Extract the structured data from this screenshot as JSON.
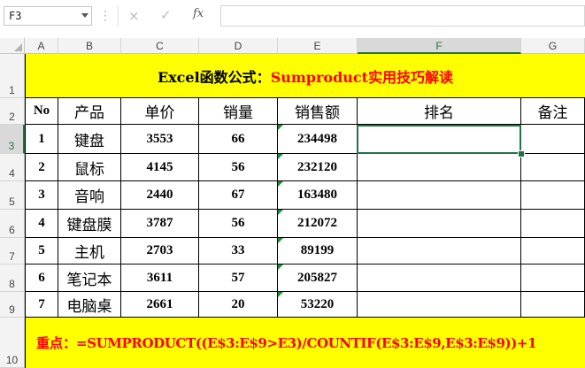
{
  "formula_bar": {
    "name_box": "F3",
    "cancel_icon": "×",
    "enter_icon": "✓",
    "fx_label": "fx",
    "formula": ""
  },
  "columns": [
    "A",
    "B",
    "C",
    "D",
    "E",
    "F",
    "G"
  ],
  "selected_column": "F",
  "rows": [
    "1",
    "2",
    "3",
    "4",
    "5",
    "6",
    "7",
    "8",
    "9",
    "10"
  ],
  "selected_row": "3",
  "title": {
    "part1": "Excel函数公式：",
    "part2": "Sumproduct实用技巧解读"
  },
  "table": {
    "headers": [
      "No",
      "产品",
      "单价",
      "销量",
      "销售额",
      "排名",
      "备注"
    ],
    "rows": [
      [
        "1",
        "键盘",
        "3553",
        "66",
        "234498",
        "",
        ""
      ],
      [
        "2",
        "鼠标",
        "4145",
        "56",
        "232120",
        "",
        ""
      ],
      [
        "3",
        "音响",
        "2440",
        "67",
        "163480",
        "",
        ""
      ],
      [
        "4",
        "键盘膜",
        "3787",
        "56",
        "212072",
        "",
        ""
      ],
      [
        "5",
        "主机",
        "2703",
        "33",
        "89199",
        "",
        ""
      ],
      [
        "6",
        "笔记本",
        "3611",
        "57",
        "205827",
        "",
        ""
      ],
      [
        "7",
        "电脑桌",
        "2661",
        "20",
        "53220",
        "",
        ""
      ]
    ]
  },
  "footer": {
    "label": "重点：",
    "formula": "=SUMPRODUCT((E$3:E$9>E3)/COUNTIF(E$3:E$9,E$3:E$9))+1"
  },
  "colors": {
    "highlight_band": "#ffff00",
    "emphasis_text": "#ff0000",
    "selection": "#217346"
  }
}
